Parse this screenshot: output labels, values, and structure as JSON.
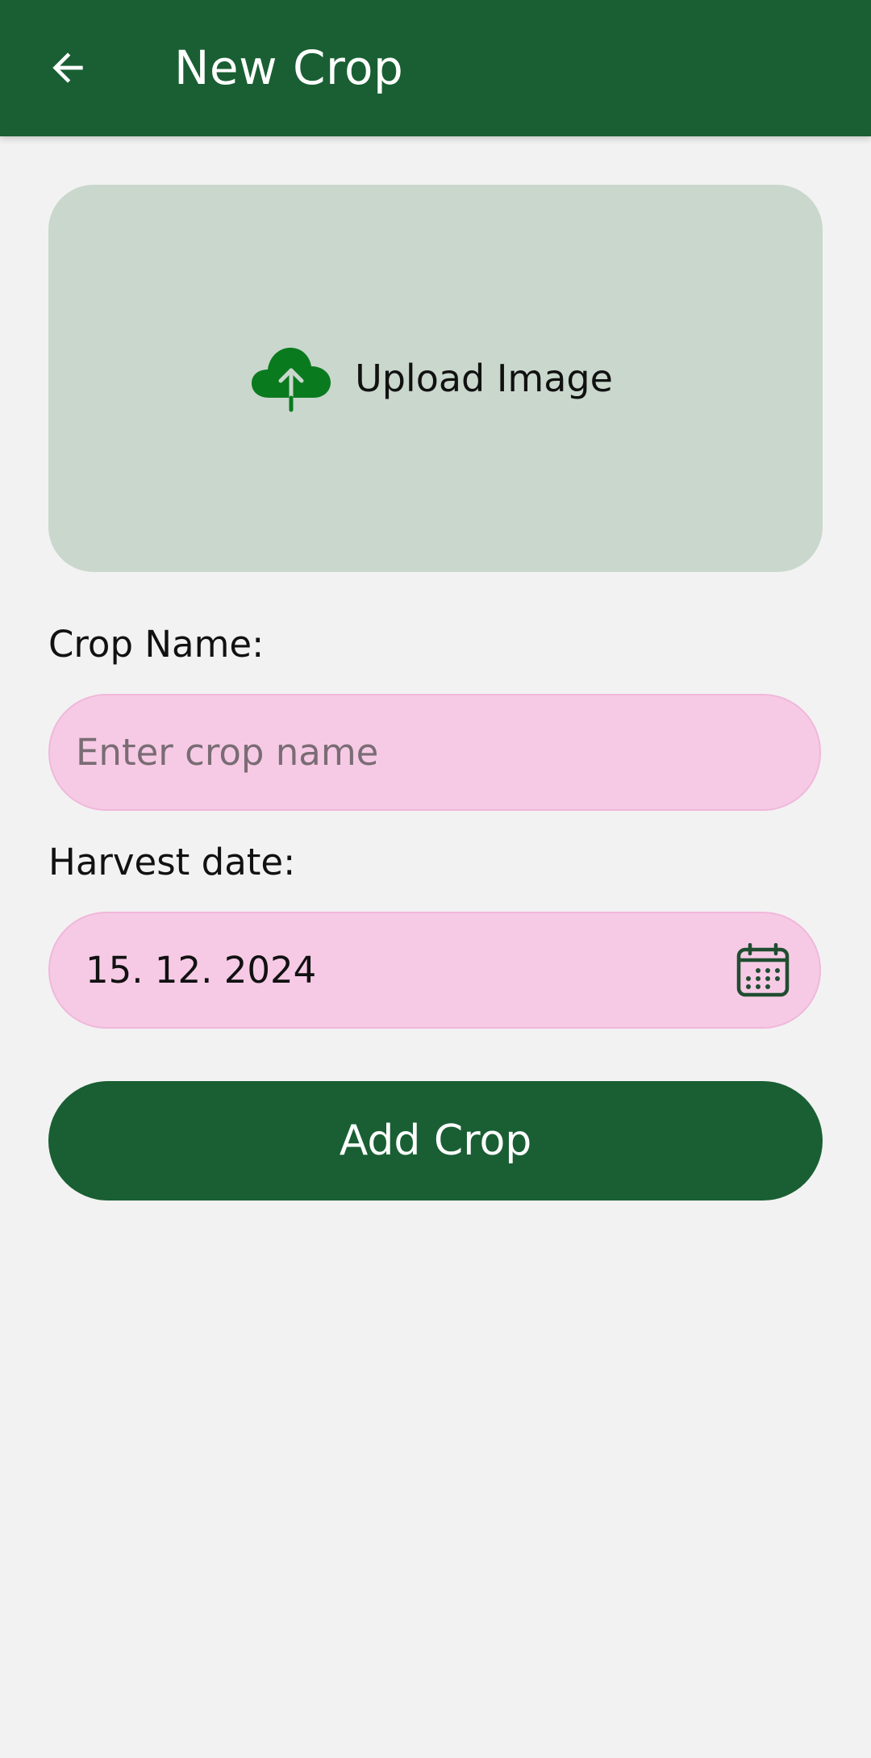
{
  "header": {
    "title": "New Crop",
    "back_icon": "arrow-left-icon"
  },
  "upload": {
    "label": "Upload Image",
    "icon": "cloud-upload-icon",
    "icon_color": "#0a7a1e"
  },
  "form": {
    "crop_name_label": "Crop Name:",
    "crop_name_placeholder": "Enter crop name",
    "crop_name_value": "",
    "harvest_date_label": "Harvest date:",
    "harvest_date_value": "15. 12. 2024",
    "calendar_icon": "calendar-icon"
  },
  "actions": {
    "add_label": "Add Crop"
  },
  "colors": {
    "primary": "#195f33",
    "background": "#f2f2f2",
    "upload_area": "#c9d7cd",
    "input_fill": "#f6cae5"
  }
}
